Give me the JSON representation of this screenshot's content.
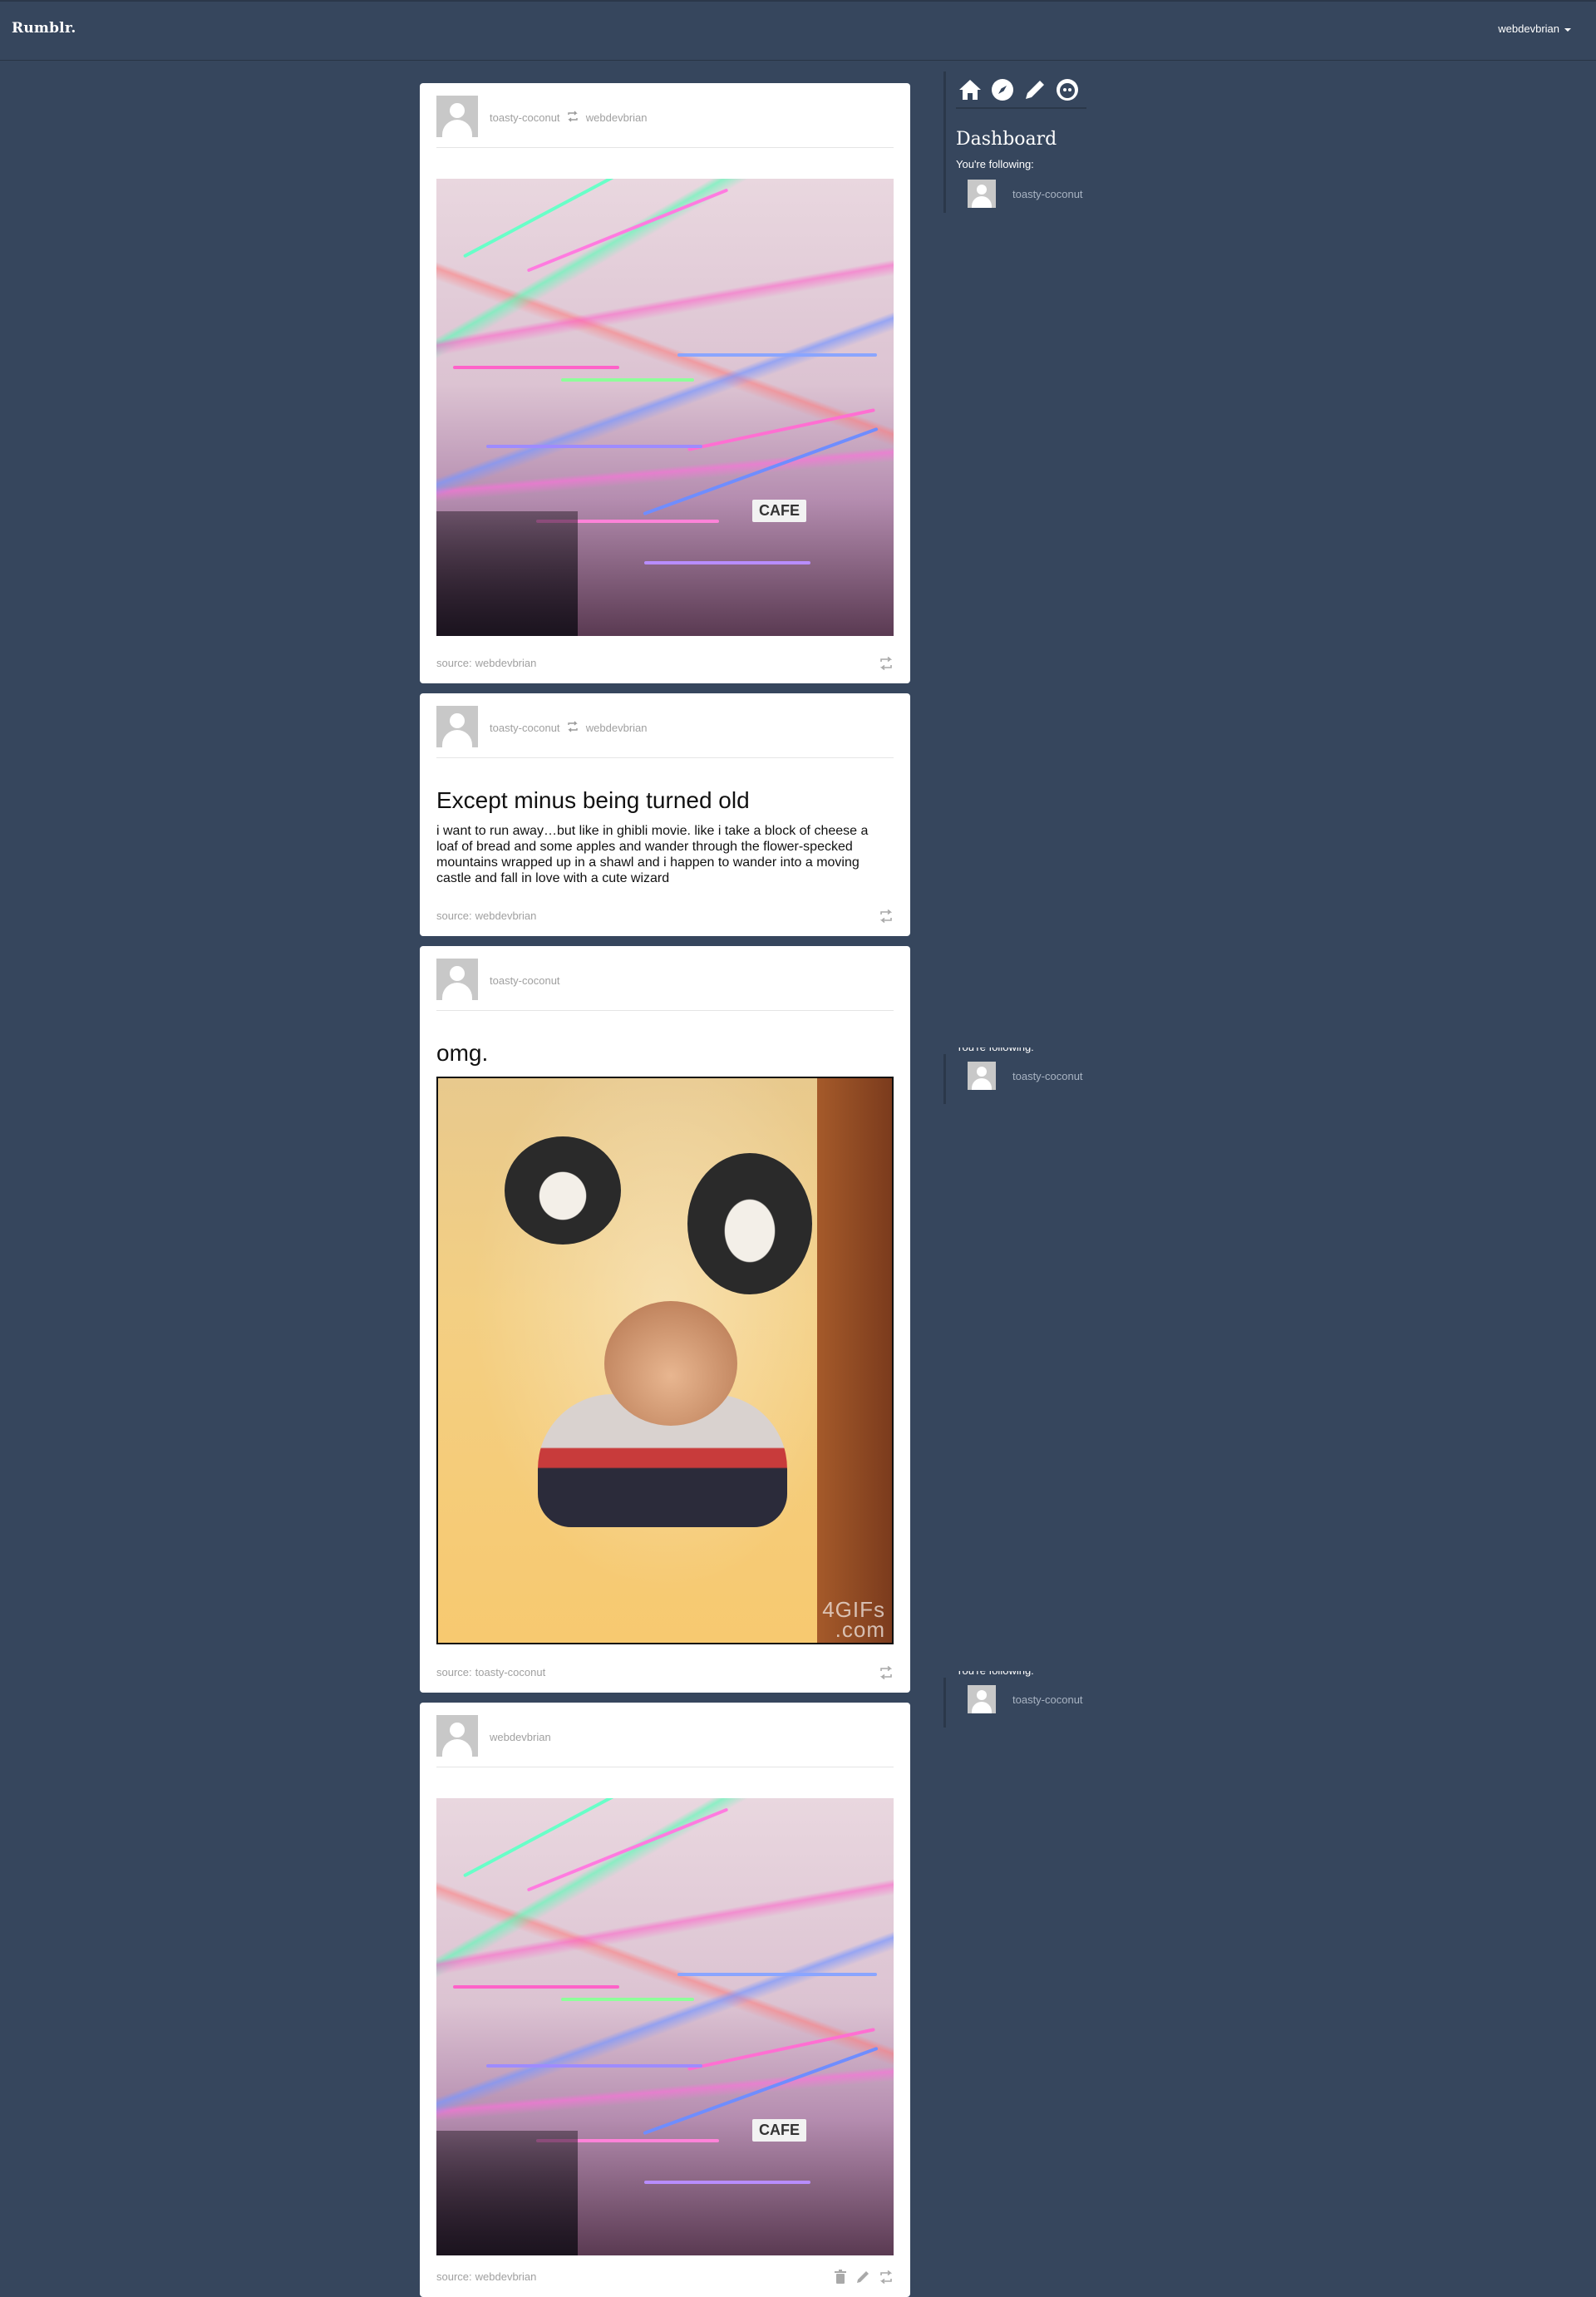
{
  "app": {
    "logo": "Rumblr."
  },
  "header": {
    "user_menu_label": "webdevbrian"
  },
  "sidebar": {
    "nav_icons": [
      "home-icon",
      "compass-icon",
      "pencil-icon",
      "avatar-face-icon"
    ],
    "title": "Dashboard",
    "following_label": "You're following:",
    "following": [
      {
        "name": "toasty-coconut"
      }
    ],
    "repeat_blocks": [
      {
        "following_label": "You're following:",
        "following_name": "toasty-coconut"
      },
      {
        "following_label": "You're following:",
        "following_name": "toasty-coconut"
      }
    ]
  },
  "posts": [
    {
      "type": "photo",
      "author": "toasty-coconut",
      "reblogged_from": "webdevbrian",
      "image_sign_text": "CAFE",
      "source_label": "source:",
      "source_name": "webdevbrian"
    },
    {
      "type": "text",
      "author": "toasty-coconut",
      "reblogged_from": "webdevbrian",
      "title": "Except minus being turned old",
      "body": "i want to run away…but like in ghibli movie. like i take a block of cheese a loaf of bread and some apples and wander through the flower-specked mountains wrapped up in a shawl and i happen to wander into a moving castle and fall in love with a cute wizard",
      "source_label": "source:",
      "source_name": "webdevbrian"
    },
    {
      "type": "photo",
      "author": "toasty-coconut",
      "title": "omg.",
      "watermark": "4GIFs\n.com",
      "source_label": "source:",
      "source_name": "toasty-coconut"
    },
    {
      "type": "photo",
      "author": "webdevbrian",
      "image_sign_text": "CAFE",
      "source_label": "source:",
      "source_name": "webdevbrian"
    }
  ],
  "colors": {
    "background": "#36465d",
    "card": "#ffffff",
    "muted_text": "#a0a0a0"
  }
}
